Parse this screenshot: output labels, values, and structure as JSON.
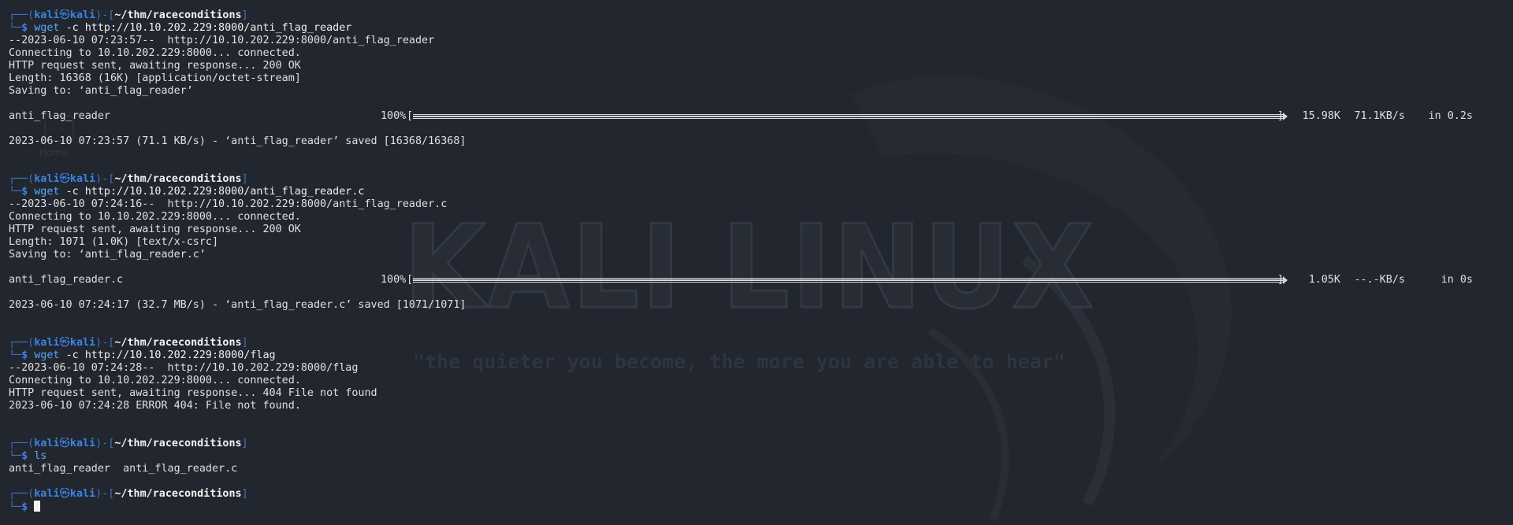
{
  "prompt": {
    "user": "kali",
    "at": "㉿",
    "host": "kali",
    "cwd": "~/thm/raceconditions"
  },
  "wallpaper": {
    "logo_text": "KALI LINUX",
    "quote": "\"the quieter you become, the more you are able to hear\"",
    "desktop_icon_label": "Home"
  },
  "blocks": [
    {
      "command": "wget",
      "args": "-c http://10.10.202.229:8000/anti_flag_reader",
      "output": [
        "--2023-06-10 07:23:57--  http://10.10.202.229:8000/anti_flag_reader",
        "Connecting to 10.10.202.229:8000... connected.",
        "HTTP request sent, awaiting response... 200 OK",
        "Length: 16368 (16K) [application/octet-stream]",
        "Saving to: ‘anti_flag_reader’"
      ],
      "progress": {
        "filename": "anti_flag_reader",
        "percent_text": "100%",
        "fraction": 1.0,
        "size": "15.98K",
        "speed": "71.1KB/s",
        "time": "in 0.2s"
      },
      "result": "2023-06-10 07:23:57 (71.1 KB/s) - ‘anti_flag_reader’ saved [16368/16368]"
    },
    {
      "command": "wget",
      "args": "-c http://10.10.202.229:8000/anti_flag_reader.c",
      "output": [
        "--2023-06-10 07:24:16--  http://10.10.202.229:8000/anti_flag_reader.c",
        "Connecting to 10.10.202.229:8000... connected.",
        "HTTP request sent, awaiting response... 200 OK",
        "Length: 1071 (1.0K) [text/x-csrc]",
        "Saving to: ‘anti_flag_reader.c’"
      ],
      "progress": {
        "filename": "anti_flag_reader.c",
        "percent_text": "100%",
        "fraction": 1.0,
        "size": "1.05K",
        "speed": "--.-KB/s",
        "time": "in 0s"
      },
      "result": "2023-06-10 07:24:17 (32.7 MB/s) - ‘anti_flag_reader.c’ saved [1071/1071]"
    },
    {
      "command": "wget",
      "args": "-c http://10.10.202.229:8000/flag",
      "output": [
        "--2023-06-10 07:24:28--  http://10.10.202.229:8000/flag",
        "Connecting to 10.10.202.229:8000... connected.",
        "HTTP request sent, awaiting response... 404 File not found",
        "2023-06-10 07:24:28 ERROR 404: File not found."
      ]
    },
    {
      "command": "ls",
      "args": "",
      "output": [
        "anti_flag_reader  anti_flag_reader.c"
      ]
    }
  ]
}
